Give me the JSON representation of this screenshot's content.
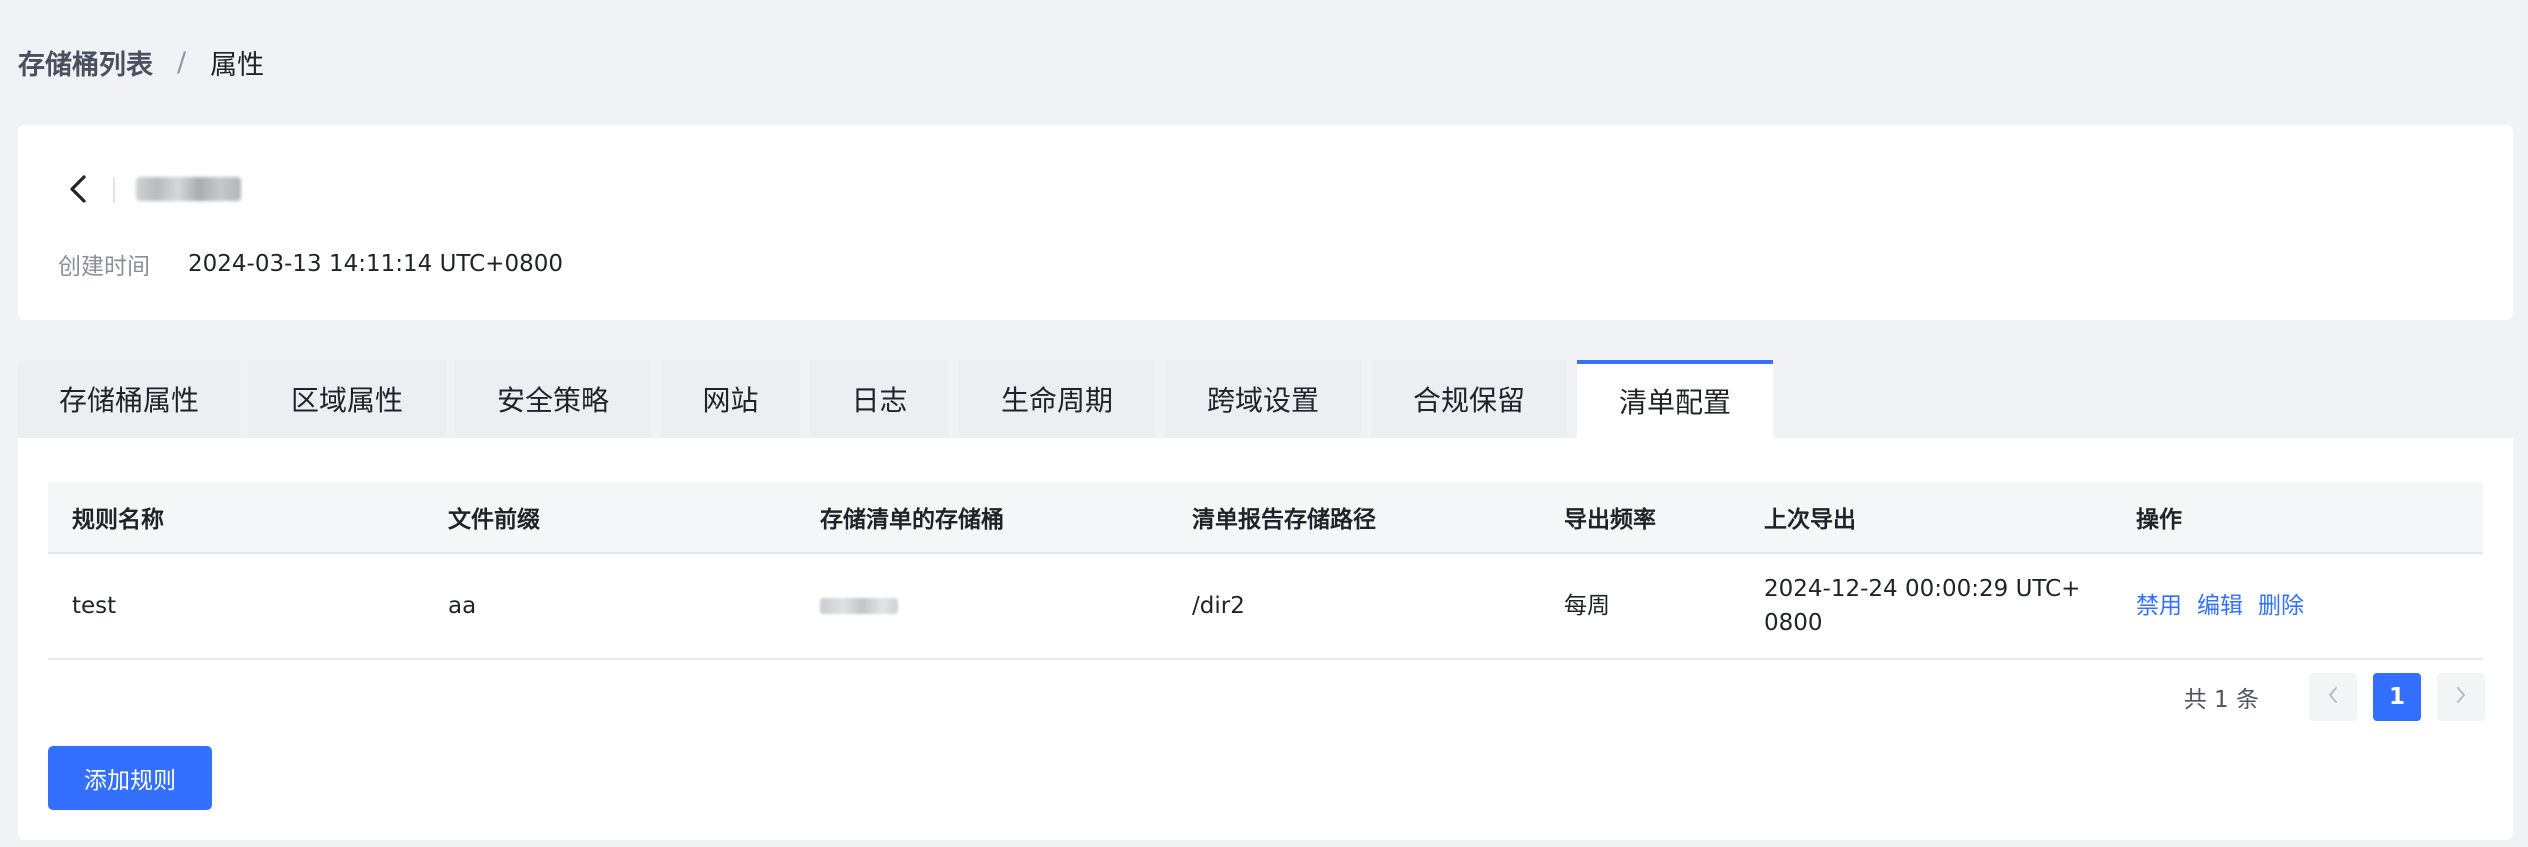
{
  "breadcrumb": {
    "parent": "存储桶列表",
    "separator": "/",
    "current": "属性"
  },
  "header": {
    "back_icon": "chevron-left-icon",
    "created_label": "创建时间",
    "created_value": "2024-03-13 14:11:14 UTC+0800"
  },
  "tabs": [
    {
      "label": "存储桶属性"
    },
    {
      "label": "区域属性"
    },
    {
      "label": "安全策略"
    },
    {
      "label": "网站"
    },
    {
      "label": "日志"
    },
    {
      "label": "生命周期"
    },
    {
      "label": "跨域设置"
    },
    {
      "label": "合规保留"
    },
    {
      "label": "清单配置",
      "active": true
    }
  ],
  "table": {
    "columns": [
      "规则名称",
      "文件前缀",
      "存储清单的存储桶",
      "清单报告存储路径",
      "导出频率",
      "上次导出",
      "操作"
    ],
    "rows": [
      {
        "name": "test",
        "prefix": "aa",
        "path": "/dir2",
        "frequency": "每周",
        "last_export": "2024-12-24 00:00:29 UTC+0800",
        "actions": [
          "禁用",
          "编辑",
          "删除"
        ]
      }
    ]
  },
  "pagination": {
    "total_text": "共 1 条",
    "current_page": "1",
    "prev_icon": "chevron-left-icon",
    "next_icon": "chevron-right-icon"
  },
  "add_button_label": "添加规则",
  "colors": {
    "primary": "#3370ff",
    "background": "#f1f2f5"
  }
}
